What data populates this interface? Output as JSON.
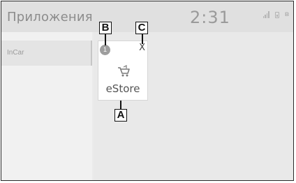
{
  "header": {
    "title": "Приложения",
    "clock": "2:31"
  },
  "sidebar": {
    "items": [
      {
        "label": "InCar"
      }
    ]
  },
  "app_tile": {
    "name": "eStore",
    "badge": "1",
    "close": "X",
    "icon": "cart-icon"
  },
  "callouts": {
    "a": "A",
    "b": "B",
    "c": "C"
  },
  "status_icons": [
    "signal-icon",
    "phone-battery-icon",
    "bluetooth-icon"
  ]
}
